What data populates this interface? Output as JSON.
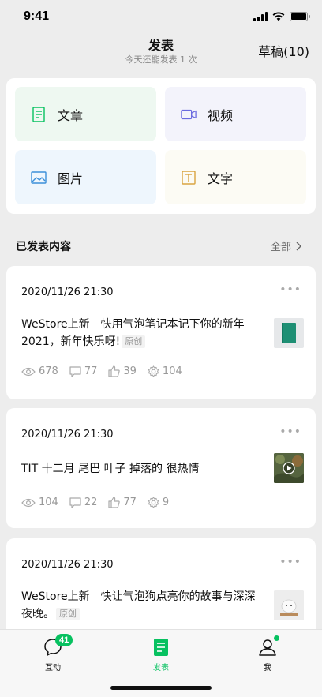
{
  "status": {
    "time": "9:41"
  },
  "header": {
    "title": "发表",
    "subtitle": "今天还能发表 1 次",
    "drafts_label": "草稿(10)"
  },
  "create": {
    "article": "文章",
    "video": "视频",
    "image": "图片",
    "text": "文字"
  },
  "section": {
    "title": "已发表内容",
    "all_label": "全部"
  },
  "posts": [
    {
      "date": "2020/11/26 21:30",
      "title": "WeStore上新｜快用气泡笔记本记下你的新年2021，新年快乐呀!",
      "badge": "原创",
      "views": "678",
      "comments": "77",
      "likes": "39",
      "shares": "104"
    },
    {
      "date": "2020/11/26 21:30",
      "title": "TIT 十二月 尾巴 叶子 掉落的 很热情",
      "views": "104",
      "comments": "22",
      "likes": "77",
      "shares": "9"
    },
    {
      "date": "2020/11/26 21:30",
      "title": "WeStore上新｜快让气泡狗点亮你的故事与深深夜晚。",
      "badge": "原创"
    }
  ],
  "tabs": {
    "interact": "互动",
    "interact_badge": "41",
    "publish": "发表",
    "me": "我"
  },
  "colors": {
    "accent": "#07C160",
    "background": "#EDEDED"
  }
}
